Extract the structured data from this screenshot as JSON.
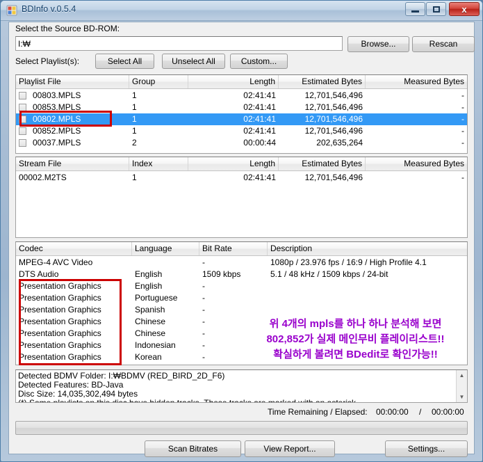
{
  "window": {
    "title": "BDInfo v.0.5.4",
    "icon": "app-grid-icon",
    "minimize_label": "Minimize",
    "maximize_label": "Maximize",
    "close_label": "x"
  },
  "source": {
    "label": "Select the Source BD-ROM:",
    "value": "I:₩",
    "placeholder": "",
    "browse_label": "Browse...",
    "rescan_label": "Rescan"
  },
  "playlist_controls": {
    "label": "Select Playlist(s):",
    "select_all_label": "Select All",
    "unselect_all_label": "Unselect All",
    "custom_label": "Custom..."
  },
  "playlist_table": {
    "columns": [
      "Playlist File",
      "Group",
      "Length",
      "Estimated Bytes",
      "Measured Bytes"
    ],
    "rows": [
      {
        "file": "00803.MPLS",
        "group": "1",
        "length": "02:41:41",
        "estimated": "12,701,546,496",
        "measured": "-",
        "selected": false,
        "checked": false
      },
      {
        "file": "00853.MPLS",
        "group": "1",
        "length": "02:41:41",
        "estimated": "12,701,546,496",
        "measured": "-",
        "selected": false,
        "checked": false
      },
      {
        "file": "00802.MPLS",
        "group": "1",
        "length": "02:41:41",
        "estimated": "12,701,546,496",
        "measured": "-",
        "selected": true,
        "checked": false
      },
      {
        "file": "00852.MPLS",
        "group": "1",
        "length": "02:41:41",
        "estimated": "12,701,546,496",
        "measured": "-",
        "selected": false,
        "checked": false
      },
      {
        "file": "00037.MPLS",
        "group": "2",
        "length": "00:00:44",
        "estimated": "202,635,264",
        "measured": "-",
        "selected": false,
        "checked": false
      }
    ]
  },
  "stream_table": {
    "columns": [
      "Stream File",
      "Index",
      "Length",
      "Estimated Bytes",
      "Measured Bytes"
    ],
    "rows": [
      {
        "file": "00002.M2TS",
        "index": "1",
        "length": "02:41:41",
        "estimated": "12,701,546,496",
        "measured": "-"
      }
    ]
  },
  "codec_table": {
    "columns": [
      "Codec",
      "Language",
      "Bit Rate",
      "Description"
    ],
    "rows": [
      {
        "codec": "MPEG-4 AVC Video",
        "language": "",
        "bitrate": "-",
        "description": "1080p / 23.976 fps / 16:9 / High Profile 4.1"
      },
      {
        "codec": "DTS Audio",
        "language": "English",
        "bitrate": "1509 kbps",
        "description": "5.1 / 48 kHz / 1509 kbps / 24-bit"
      },
      {
        "codec": "Presentation Graphics",
        "language": "English",
        "bitrate": "-",
        "description": ""
      },
      {
        "codec": "Presentation Graphics",
        "language": "Portuguese",
        "bitrate": "-",
        "description": ""
      },
      {
        "codec": "Presentation Graphics",
        "language": "Spanish",
        "bitrate": "-",
        "description": ""
      },
      {
        "codec": "Presentation Graphics",
        "language": "Chinese",
        "bitrate": "-",
        "description": ""
      },
      {
        "codec": "Presentation Graphics",
        "language": "Chinese",
        "bitrate": "-",
        "description": ""
      },
      {
        "codec": "Presentation Graphics",
        "language": "Indonesian",
        "bitrate": "-",
        "description": ""
      },
      {
        "codec": "Presentation Graphics",
        "language": "Korean",
        "bitrate": "-",
        "description": ""
      }
    ]
  },
  "annotation": {
    "color": "#9900cc",
    "box_color": "#cc0000",
    "line1": "위 4개의 mpls를 하나 하나 분석해 보면",
    "line2": "802,852가 실제 메인무비 플레이리스트!!",
    "line3": "확실하게 볼려면 BDedit로 확인가능!!"
  },
  "info_panel": {
    "lines": [
      "Detected BDMV Folder: I:₩BDMV (RED_BIRD_2D_F6)",
      "Detected Features: BD-Java",
      "Disc Size: 14,035,302,494 bytes",
      "(*) Some playlists on this disc have hidden tracks. These tracks are marked with an asterisk."
    ],
    "scroll_up_icon": "▲",
    "scroll_down_icon": "▼"
  },
  "status": {
    "label": "Time Remaining / Elapsed:",
    "remaining": "00:00:00",
    "divider": "/",
    "elapsed": "00:00:00"
  },
  "footer": {
    "scan_label": "Scan Bitrates",
    "report_label": "View Report...",
    "settings_label": "Settings..."
  }
}
